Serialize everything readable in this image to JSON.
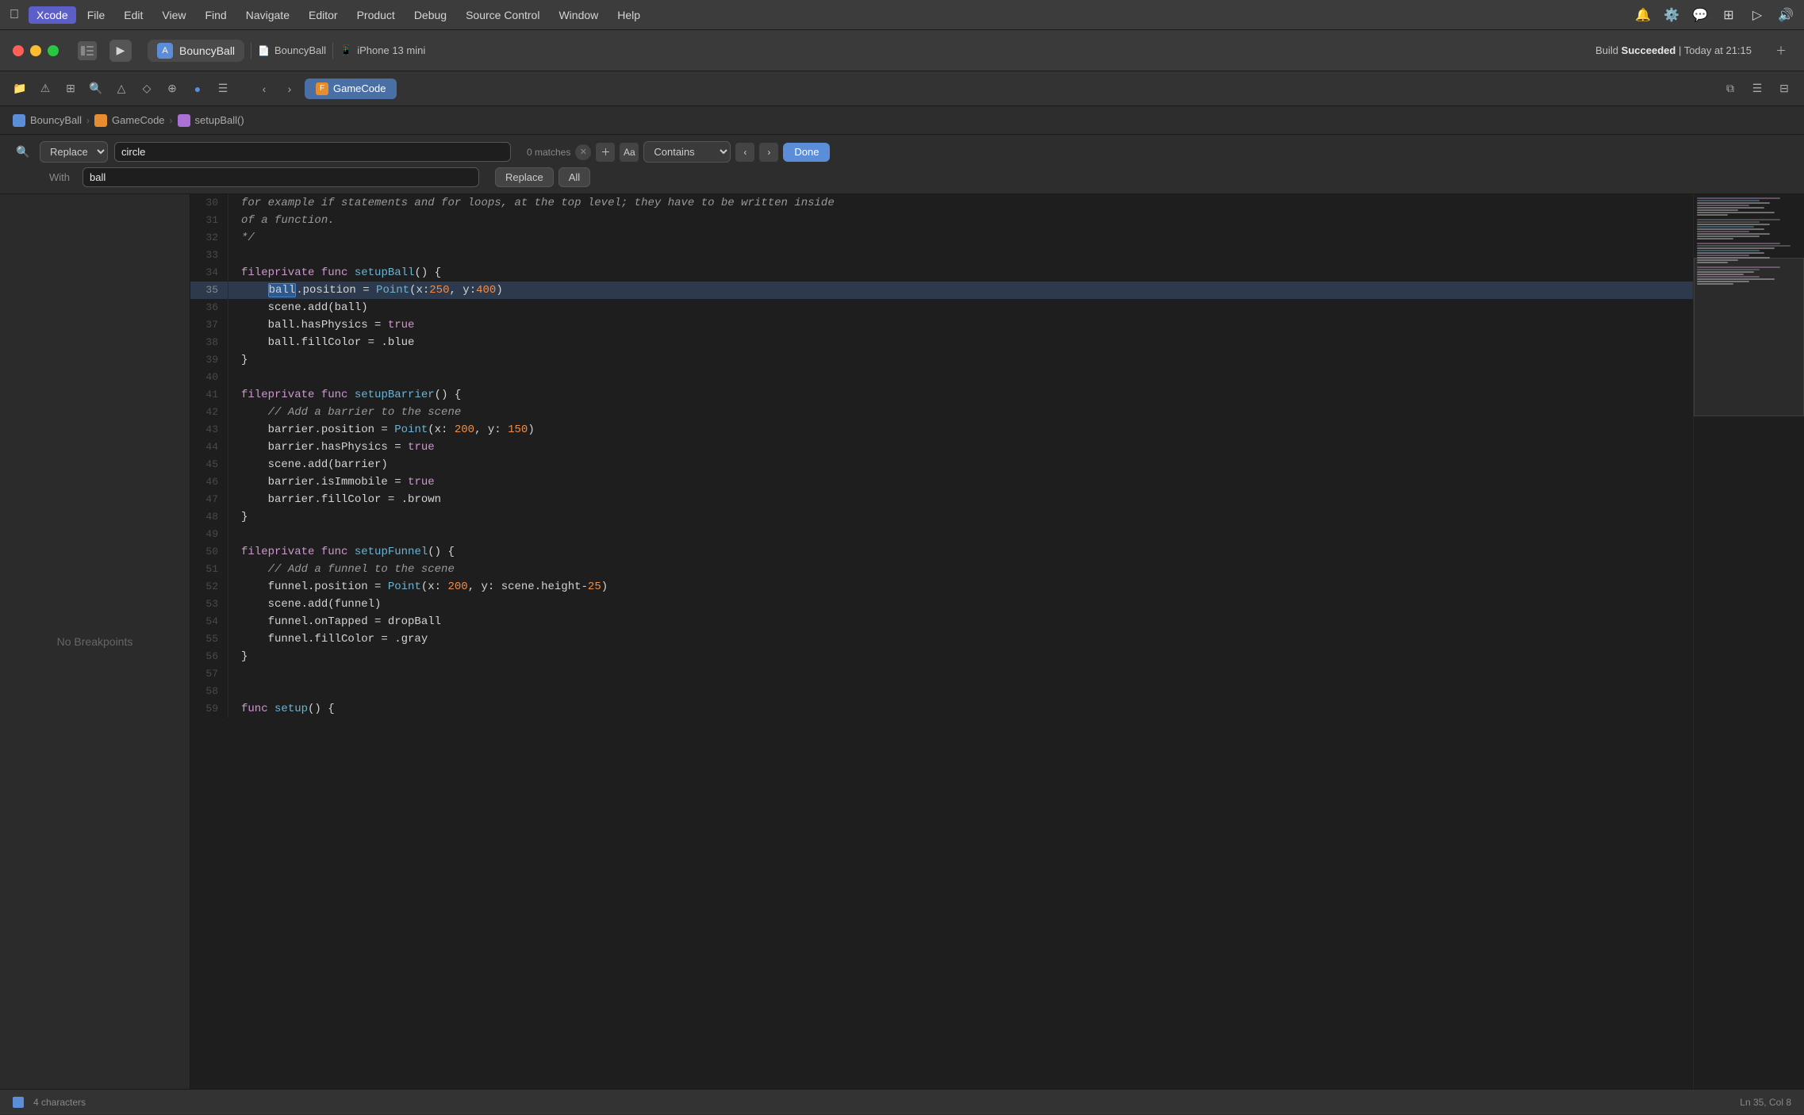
{
  "menubar": {
    "apple": "🍎",
    "items": [
      "Xcode",
      "File",
      "Edit",
      "View",
      "Find",
      "Navigate",
      "Editor",
      "Product",
      "Debug",
      "Source Control",
      "Window",
      "Help"
    ]
  },
  "toolbar": {
    "project_name": "BouncyBall",
    "scheme": "BouncyBall",
    "device": "iPhone 13 mini",
    "build_label": "Build",
    "build_status": "Succeeded",
    "build_time": "Today at 21:15"
  },
  "tabs": {
    "active": "GameCode"
  },
  "breadcrumb": {
    "project": "BouncyBall",
    "file": "GameCode",
    "function": "setupBall()"
  },
  "find_replace": {
    "mode_label": "Replace",
    "search_value": "circle",
    "replace_value": "ball",
    "match_count": "0 matches",
    "with_label": "With",
    "contains_label": "Contains",
    "aa_label": "Aa",
    "done_label": "Done",
    "replace_label": "Replace",
    "all_label": "All"
  },
  "left_panel": {
    "no_breakpoints": "No Breakpoints"
  },
  "code_lines": [
    {
      "num": "30",
      "content": "for example if statements and for loops, at the top level; they have to be written inside",
      "type": "comment"
    },
    {
      "num": "31",
      "content": "of a function.",
      "type": "comment"
    },
    {
      "num": "32",
      "content": "*/",
      "type": "comment"
    },
    {
      "num": "33",
      "content": "",
      "type": "plain"
    },
    {
      "num": "34",
      "content": "fileprivate func setupBall() {",
      "type": "code"
    },
    {
      "num": "35",
      "content": "    ball.position = Point(x:250, y:400)",
      "type": "code",
      "highlight": true
    },
    {
      "num": "36",
      "content": "    scene.add(ball)",
      "type": "code"
    },
    {
      "num": "37",
      "content": "    ball.hasPhysics = true",
      "type": "code"
    },
    {
      "num": "38",
      "content": "    ball.fillColor = .blue",
      "type": "code"
    },
    {
      "num": "39",
      "content": "}",
      "type": "code"
    },
    {
      "num": "40",
      "content": "",
      "type": "plain"
    },
    {
      "num": "41",
      "content": "fileprivate func setupBarrier() {",
      "type": "code"
    },
    {
      "num": "42",
      "content": "    // Add a barrier to the scene",
      "type": "comment"
    },
    {
      "num": "43",
      "content": "    barrier.position = Point(x: 200, y: 150)",
      "type": "code"
    },
    {
      "num": "44",
      "content": "    barrier.hasPhysics = true",
      "type": "code"
    },
    {
      "num": "45",
      "content": "    scene.add(barrier)",
      "type": "code"
    },
    {
      "num": "46",
      "content": "    barrier.isImmobile = true",
      "type": "code"
    },
    {
      "num": "47",
      "content": "    barrier.fillColor = .brown",
      "type": "code"
    },
    {
      "num": "48",
      "content": "}",
      "type": "code"
    },
    {
      "num": "49",
      "content": "",
      "type": "plain"
    },
    {
      "num": "50",
      "content": "fileprivate func setupFunnel() {",
      "type": "code"
    },
    {
      "num": "51",
      "content": "    // Add a funnel to the scene",
      "type": "comment"
    },
    {
      "num": "52",
      "content": "    funnel.position = Point(x: 200, y: scene.height-25)",
      "type": "code"
    },
    {
      "num": "53",
      "content": "    scene.add(funnel)",
      "type": "code"
    },
    {
      "num": "54",
      "content": "    funnel.onTapped = dropBall",
      "type": "code"
    },
    {
      "num": "55",
      "content": "    funnel.fillColor = .gray",
      "type": "code"
    },
    {
      "num": "56",
      "content": "}",
      "type": "code"
    },
    {
      "num": "57",
      "content": "",
      "type": "plain"
    },
    {
      "num": "58",
      "content": "",
      "type": "plain"
    },
    {
      "num": "59",
      "content": "func setup() {",
      "type": "code"
    }
  ],
  "status_bar": {
    "chars": "4 characters"
  }
}
